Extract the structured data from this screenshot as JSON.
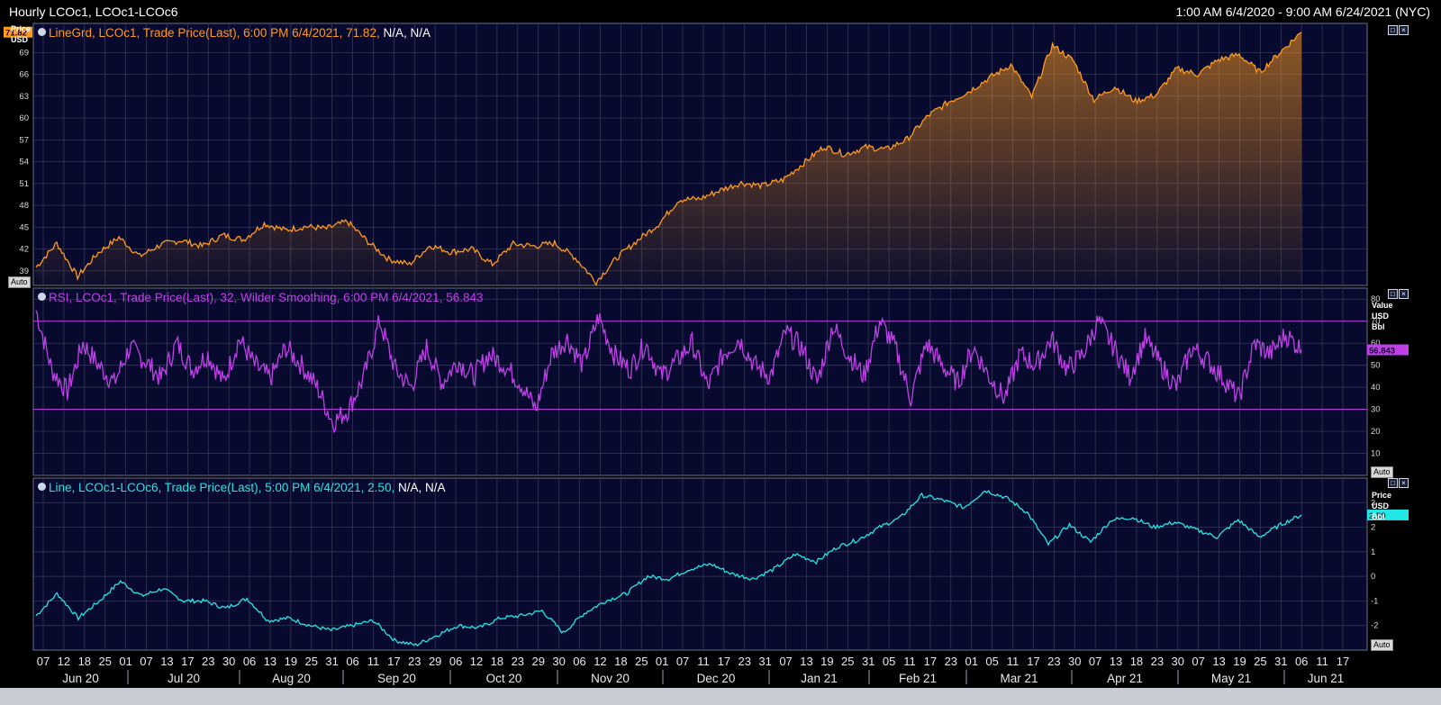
{
  "header": {
    "title": "Hourly LCOc1, LCOc1-LCOc6",
    "range": "1:00 AM 6/4/2020 - 9:00 AM 6/24/2021 (NYC)"
  },
  "colors": {
    "background": "#070a2e",
    "grid": "#3a3e5a",
    "price": "#ff9a1f",
    "rsi": "#c040e8",
    "spread": "#23e6e6",
    "last_marker_bg": "#ff9a1f"
  },
  "panels": {
    "price": {
      "legend_main": "LineGrd, LCOc1, Trade Price(Last), 6:00 PM 6/4/2021, 71.82,",
      "legend_tail": "N/A, N/A",
      "unit_label": "Price\nUSD",
      "last_value": "71.82",
      "auto_label": "Auto"
    },
    "rsi": {
      "legend_main": "RSI, LCOc1, Trade Price(Last),  32, Wilder Smoothing, 6:00 PM 6/4/2021, 56.843",
      "unit_label": "Value\nUSD\nBbl",
      "last_value": "56.843",
      "auto_label": "Auto"
    },
    "spread": {
      "legend_main": "Line, LCOc1-LCOc6, Trade Price(Last), 5:00 PM 6/4/2021, 2.50,",
      "legend_tail": "N/A, N/A",
      "unit_label": "Price\nUSD\nBbl",
      "last_value": "2.50",
      "auto_label": "Auto"
    }
  },
  "chart_data": [
    {
      "type": "area",
      "series": [
        {
          "name": "LCOc1",
          "values": [
            39.5,
            42.8,
            38.2,
            41.5,
            43.6,
            41,
            42.6,
            43.2,
            42.4,
            43.9,
            43.3,
            45.5,
            44.6,
            45.1,
            44.8,
            45.8,
            43,
            40.6,
            39.9,
            42.5,
            41.6,
            42,
            39.9,
            42.7,
            42.4,
            42.8,
            40.8,
            37.5,
            40.8,
            43.2,
            45.4,
            48.8,
            48.9,
            50.1,
            51.1,
            50.7,
            51.5,
            53.8,
            56.1,
            55,
            56,
            55.7,
            57.1,
            60.3,
            62.2,
            63.7,
            65.6,
            67.3,
            62.9,
            70,
            67.9,
            62.5,
            64.3,
            62.3,
            63.2,
            66.8,
            66,
            68,
            68.7,
            66.3,
            69.1,
            71.8
          ]
        }
      ],
      "ylim": [
        37,
        73
      ],
      "y_ticks": [
        "39",
        "42",
        "45",
        "48",
        "51",
        "54",
        "57",
        "60",
        "63",
        "66",
        "69"
      ],
      "ylabel": "Price USD"
    },
    {
      "type": "line",
      "series": [
        {
          "name": "RSI",
          "values": [
            75,
            48,
            38,
            60,
            50,
            42,
            58,
            52,
            44,
            60,
            48,
            55,
            42,
            62,
            50,
            44,
            58,
            50,
            40,
            24,
            30,
            45,
            70,
            48,
            40,
            58,
            42,
            52,
            45,
            55,
            50,
            42,
            30,
            55,
            62,
            50,
            72,
            55,
            48,
            60,
            45,
            52,
            60,
            40,
            55,
            62,
            50,
            45,
            65,
            58,
            42,
            68,
            55,
            45,
            70,
            58,
            35,
            60,
            50,
            42,
            58,
            45,
            35,
            55,
            50,
            62,
            48,
            55,
            70,
            58,
            45,
            62,
            50,
            40,
            58,
            52,
            44,
            35,
            60,
            55,
            64,
            57
          ]
        }
      ],
      "reference_lines": [
        30,
        70
      ],
      "ylim": [
        0,
        85
      ],
      "y_ticks": [
        "10",
        "20",
        "30",
        "40",
        "50",
        "60",
        "70",
        "80"
      ],
      "ylabel": "Value USD Bbl"
    },
    {
      "type": "line",
      "series": [
        {
          "name": "LCOc1-LCOc6",
          "values": [
            -1.6,
            -0.7,
            -1.7,
            -1.0,
            -0.2,
            -0.8,
            -0.5,
            -1.0,
            -1.0,
            -1.3,
            -0.9,
            -1.8,
            -1.7,
            -2.0,
            -2.2,
            -2.0,
            -1.8,
            -2.6,
            -2.8,
            -2.4,
            -2.0,
            -2.1,
            -1.7,
            -1.6,
            -1.4,
            -2.3,
            -1.5,
            -1.0,
            -0.7,
            0.0,
            -0.1,
            0.3,
            0.5,
            0.1,
            -0.1,
            0.3,
            0.9,
            0.6,
            1.2,
            1.5,
            2.0,
            2.4,
            3.3,
            3.1,
            2.8,
            3.5,
            3.2,
            2.6,
            1.3,
            2.1,
            1.4,
            2.3,
            2.4,
            2.0,
            2.2,
            1.9,
            1.6,
            2.3,
            1.6,
            2.1,
            2.5
          ]
        }
      ],
      "ylim": [
        -3.0,
        4.0
      ],
      "y_ticks": [
        "-2",
        "-1",
        "0",
        "1",
        "2",
        "3"
      ],
      "ylabel": "Price USD Bbl"
    }
  ],
  "x_axis": {
    "day_ticks": [
      "07",
      "12",
      "18",
      "25",
      "01",
      "07",
      "13",
      "17",
      "23",
      "30",
      "06",
      "13",
      "19",
      "25",
      "31",
      "06",
      "11",
      "17",
      "23",
      "29",
      "06",
      "12",
      "18",
      "23",
      "29",
      "30",
      "06",
      "12",
      "18",
      "25",
      "01",
      "07",
      "11",
      "17",
      "23",
      "31",
      "07",
      "13",
      "19",
      "25",
      "31",
      "05",
      "11",
      "17",
      "23",
      "01",
      "05",
      "11",
      "17",
      "23",
      "30",
      "07",
      "13",
      "18",
      "23",
      "30",
      "07",
      "13",
      "19",
      "25",
      "31",
      "06",
      "11",
      "17"
    ],
    "months": [
      "Jun 20",
      "Jul 20",
      "Aug 20",
      "Sep 20",
      "Oct 20",
      "Nov 20",
      "Dec 20",
      "Jan 21",
      "Feb 21",
      "Mar 21",
      "Apr 21",
      "May 21",
      "Jun 21"
    ]
  }
}
